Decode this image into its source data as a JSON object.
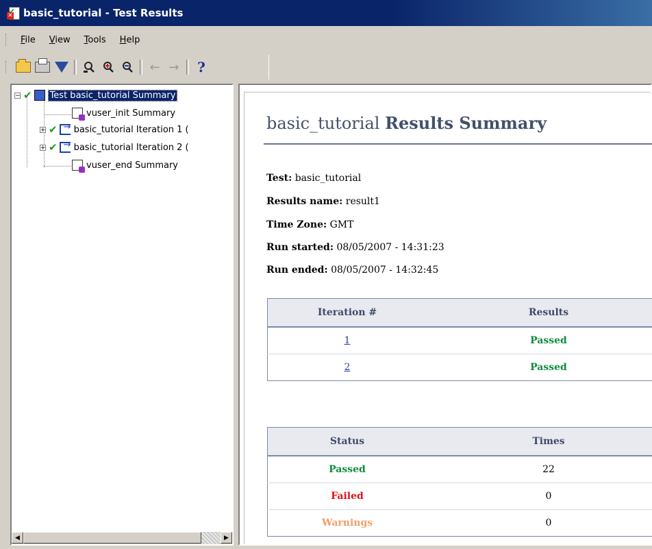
{
  "window": {
    "title": "basic_tutorial - Test Results"
  },
  "menu": [
    {
      "label": "File",
      "mnemonic": "F",
      "rest": "ile"
    },
    {
      "label": "View",
      "mnemonic": "V",
      "rest": "iew"
    },
    {
      "label": "Tools",
      "mnemonic": "T",
      "rest": "ools"
    },
    {
      "label": "Help",
      "mnemonic": "H",
      "rest": "elp"
    }
  ],
  "toolbar": {
    "icons": [
      "open-icon",
      "print-icon",
      "filter-icon",
      "find-icon",
      "zoom-in-icon",
      "zoom-out-icon",
      "back-arrow-icon",
      "forward-arrow-icon",
      "help-icon"
    ],
    "help_glyph": "?",
    "back_glyph": "←",
    "forward_glyph": "→"
  },
  "tree": {
    "root": "Test basic_tutorial Summary",
    "items": [
      {
        "label": "vuser_init Summary"
      },
      {
        "label": "basic_tutorial Iteration 1 ("
      },
      {
        "label": "basic_tutorial Iteration 2 ("
      },
      {
        "label": "vuser_end Summary"
      }
    ]
  },
  "summary": {
    "title_plain": "basic_tutorial",
    "title_bold": "Results Summary",
    "test_label": "Test:",
    "test_value": "basic_tutorial",
    "results_name_label": "Results name:",
    "results_name_value": "result1",
    "timezone_label": "Time Zone:",
    "timezone_value": "GMT",
    "run_started_label": "Run started:",
    "run_started_value": "08/05/2007 - 14:31:23",
    "run_ended_label": "Run ended:",
    "run_ended_value": "08/05/2007 - 14:32:45"
  },
  "iterations_table": {
    "headers": [
      "Iteration #",
      "Results"
    ],
    "rows": [
      {
        "iteration": "1",
        "result": "Passed"
      },
      {
        "iteration": "2",
        "result": "Passed"
      }
    ]
  },
  "status_table": {
    "headers": [
      "Status",
      "Times"
    ],
    "rows": [
      {
        "status": "Passed",
        "times": "22"
      },
      {
        "status": "Failed",
        "times": "0"
      },
      {
        "status": "Warnings",
        "times": "0"
      }
    ]
  },
  "colors": {
    "title_bar": "#0a246a",
    "passed": "#0f8a3e",
    "failed": "#e0101e",
    "warnings": "#f0a06a",
    "link": "#2b3f9c"
  }
}
